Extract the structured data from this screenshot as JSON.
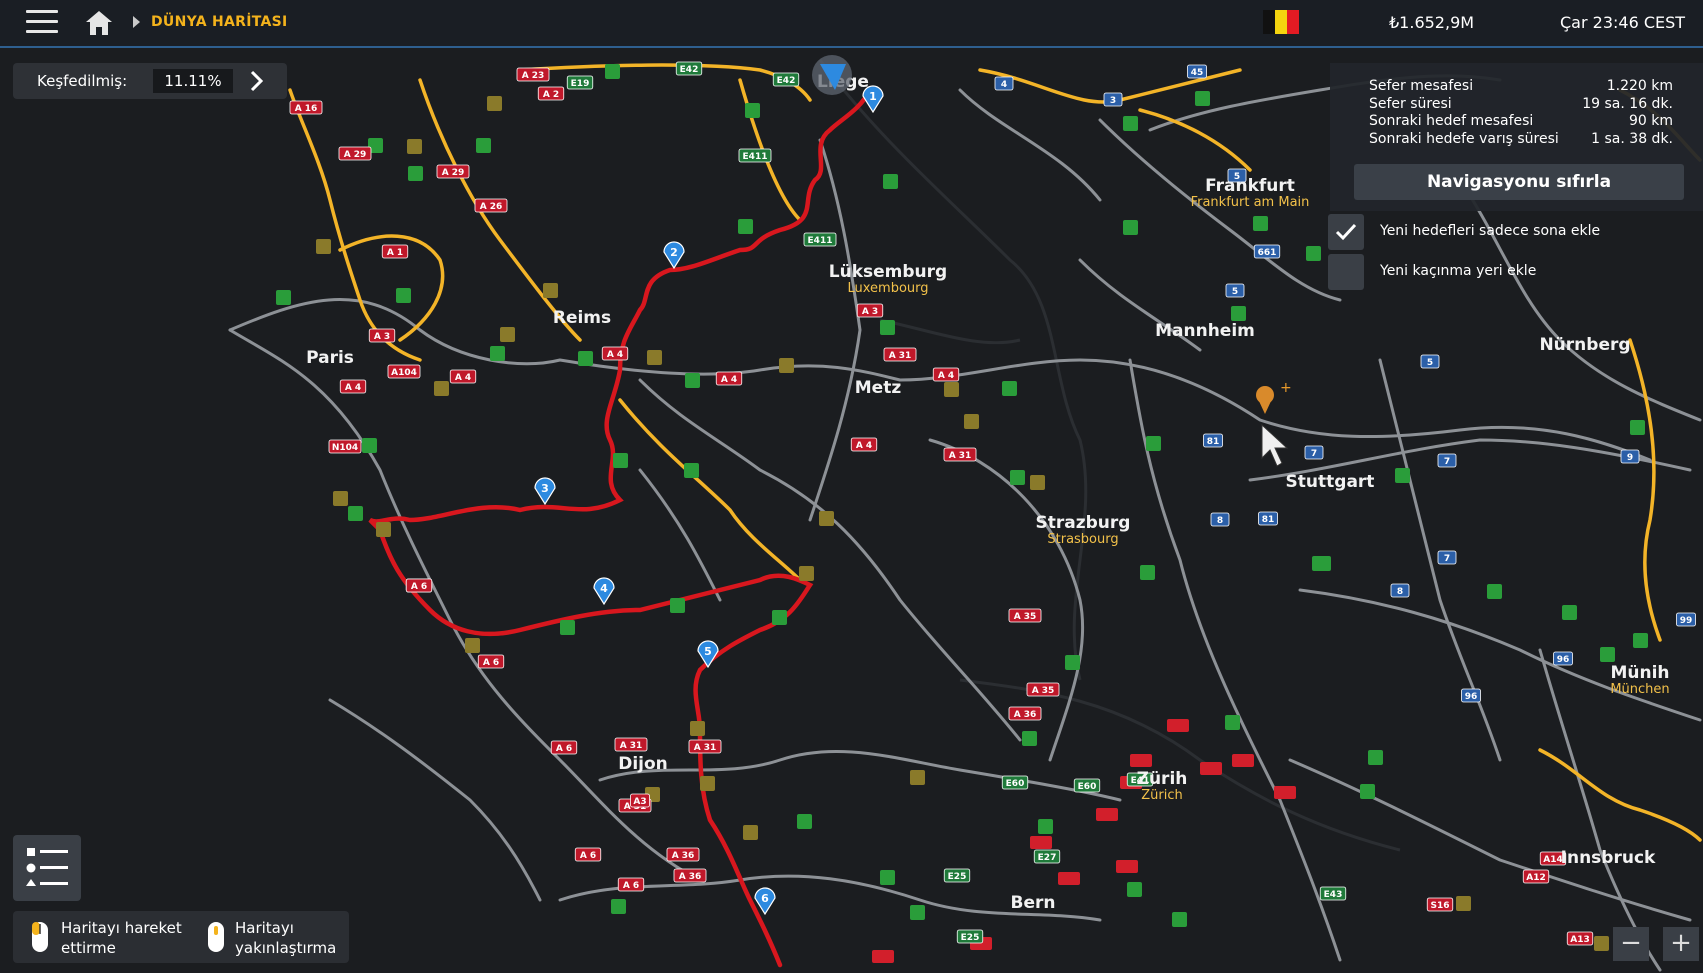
{
  "topbar": {
    "title": "DÜNYA HARİTASI",
    "money": "₺1.652,9M",
    "clock": "Çar 23:46 CEST",
    "flag_colors": [
      "#111111",
      "#f5d40f",
      "#e31b23"
    ]
  },
  "explore": {
    "label": "Keşfedilmiş:",
    "value": "11.11%"
  },
  "route_info": {
    "rows": [
      {
        "label": "Sefer mesafesi",
        "value": "1.220 km"
      },
      {
        "label": "Sefer süresi",
        "value": "19 sa. 16 dk."
      },
      {
        "label": "Sonraki hedef mesafesi",
        "value": "90 km"
      },
      {
        "label": "Sonraki hedefe varış süresi",
        "value": "1 sa. 38 dk."
      }
    ],
    "nav_button": "Navigasyonu sıfırla"
  },
  "options": [
    {
      "label": "Yeni hedefleri sadece sona ekle",
      "checked": true
    },
    {
      "label": "Yeni kaçınma yeri ekle",
      "checked": false
    }
  ],
  "controls": {
    "move_line1": "Haritayı hareket",
    "move_line2": "ettirme",
    "zoom_line1": "Haritayı",
    "zoom_line2": "yakınlaştırma"
  },
  "cities": [
    {
      "name": "Paris"
    },
    {
      "name": "Reims"
    },
    {
      "name": "Lüksemburg",
      "sub": "Luxembourg"
    },
    {
      "name": "Metz"
    },
    {
      "name": "Frankfurt",
      "sub": "Frankfurt am Main"
    },
    {
      "name": "Mannheim"
    },
    {
      "name": "Nürnberg"
    },
    {
      "name": "Stuttgart"
    },
    {
      "name": "Strazburg",
      "sub": "Strasbourg"
    },
    {
      "name": "Dijon"
    },
    {
      "name": "Zürih",
      "sub": "Zürich"
    },
    {
      "name": "Münih",
      "sub": "München"
    },
    {
      "name": "Bern"
    },
    {
      "name": "Innsbruck"
    },
    {
      "name": "Liège"
    }
  ],
  "waypoints": [
    "1",
    "2",
    "3",
    "4",
    "5",
    "6"
  ],
  "road_labels": [
    "A 16",
    "A 29",
    "A 23",
    "A 2",
    "A 26",
    "A 29",
    "A 1",
    "A 3",
    "A104",
    "A 4",
    "N104",
    "A 4",
    "A 4",
    "A 4",
    "A 31",
    "A 4",
    "A 4",
    "A 31",
    "A 35",
    "A 6",
    "A 6",
    "A 6",
    "A 31",
    "A 36",
    "A 36",
    "A 6",
    "A 31",
    "A 31",
    "A 36",
    "A 35",
    "A3",
    "A 6",
    "E19",
    "E42",
    "E42",
    "E411",
    "E411",
    "A 3",
    "A 6",
    "3",
    "4",
    "5",
    "45",
    "5",
    "661",
    "5",
    "7",
    "81",
    "8",
    "81",
    "7",
    "8",
    "7",
    "96",
    "96",
    "9",
    "99",
    "A12",
    "A14",
    "S16",
    "A13",
    "E60",
    "E41",
    "E27",
    "E25",
    "E43",
    "E60",
    "E25"
  ],
  "colors": {
    "route": "#d8171e",
    "highway": "#f3b428",
    "road": "#8d9196",
    "background": "#1b1d20",
    "accent": "#f4b31c"
  },
  "icons": {
    "menu": "hamburger-icon",
    "home": "home-icon",
    "next": "chevron-right-icon",
    "check": "check-icon",
    "legend": "legend-list-icon",
    "mouse": "mouse-icon",
    "zoom_out": "minus-icon",
    "zoom_in": "plus-icon",
    "cursor": "pointer-cursor-icon"
  },
  "zoom": {
    "out": "−",
    "in": "+"
  }
}
